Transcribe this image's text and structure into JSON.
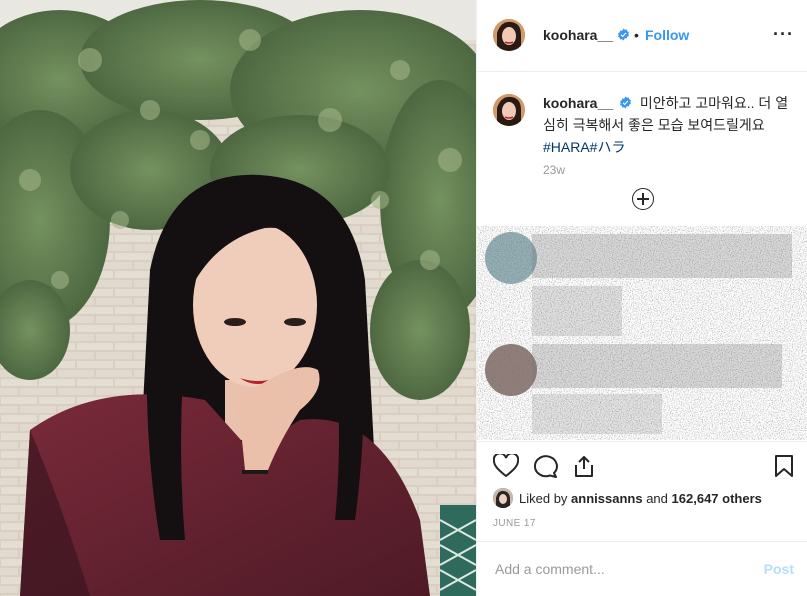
{
  "post": {
    "username": "koohara__",
    "follow_label": "Follow",
    "separator": "•",
    "more_label": "···"
  },
  "caption": {
    "username": "koohara__",
    "text": "미안하고 고마워요.. 더 열심히 극복해서 좋은 모습 보여드릴게요",
    "hashtags": "#HARA#ハラ"
  },
  "age": "23w",
  "likes": {
    "prefix": "Liked by ",
    "first_user": "annissanns",
    "middle": " and ",
    "count": "162,647 others"
  },
  "date": "JUNE 17",
  "comment": {
    "placeholder": "Add a comment...",
    "post_label": "Post"
  },
  "colors": {
    "accent": "#3897f0",
    "post_disabled": "#b2dffc",
    "verified": "#3897f0",
    "hashtag": "#003569"
  },
  "icons": [
    "verified-badge-icon",
    "more-options-icon",
    "load-more-icon",
    "heart-icon",
    "comment-icon",
    "share-icon",
    "bookmark-icon"
  ]
}
